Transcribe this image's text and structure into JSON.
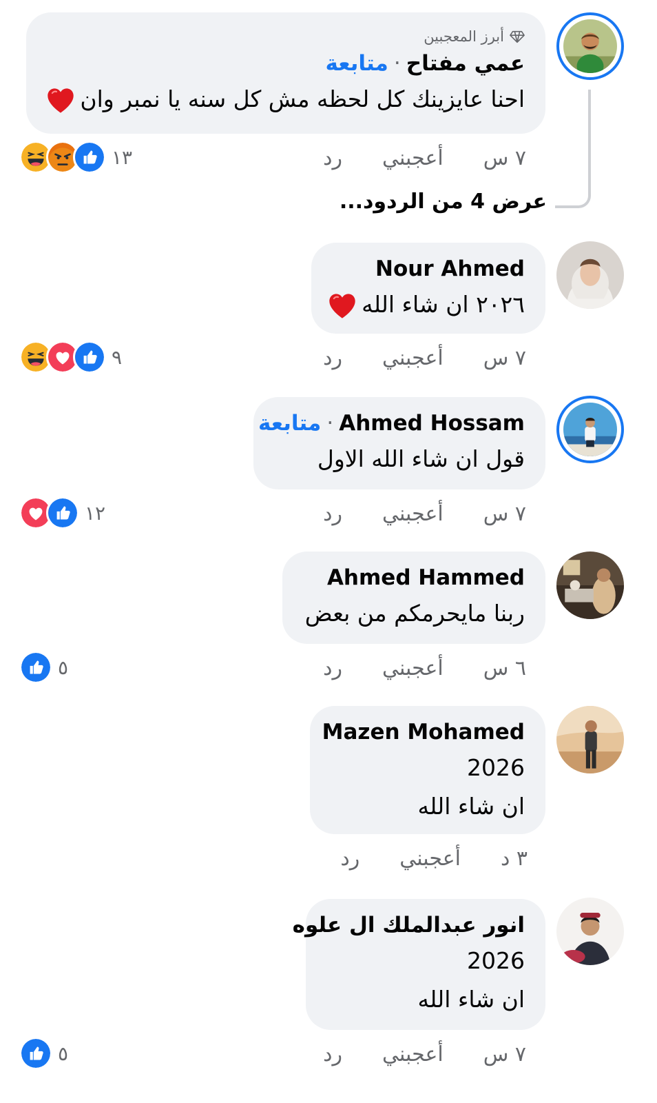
{
  "comments": [
    {
      "badge": "أبرز المعجبين",
      "name": "عمي مفتاح",
      "follow": "متابعة",
      "text": "احنا عايزينك كل لحظه مش كل سنه يا نمبر وان",
      "time": "٧ س",
      "like": "أعجبني",
      "reply": "رد",
      "reaction_count": "١٣",
      "reactions": [
        "haha-icon",
        "angry-icon",
        "like-icon"
      ],
      "view_replies": "عرض 4 من الردود..."
    },
    {
      "name": "Nour Ahmed",
      "text": "٢٠٢٦ ان شاء الله",
      "time": "٧ س",
      "like": "أعجبني",
      "reply": "رد",
      "reaction_count": "٩",
      "reactions": [
        "haha-icon",
        "love-icon",
        "like-icon"
      ]
    },
    {
      "name": "Ahmed Hossam",
      "follow": "متابعة",
      "text": "قول ان شاء الله الاول",
      "time": "٧ س",
      "like": "أعجبني",
      "reply": "رد",
      "reaction_count": "١٢",
      "reactions": [
        "love-icon",
        "like-icon"
      ]
    },
    {
      "name": "Ahmed Hammed",
      "text": "ربنا مايحرمكم من بعض",
      "time": "٦ س",
      "like": "أعجبني",
      "reply": "رد",
      "reaction_count": "٥",
      "reactions": [
        "like-icon"
      ]
    },
    {
      "name": "Mazen Mohamed",
      "text_line1": "2026",
      "text_line2": "ان شاء الله",
      "time": "٣ د",
      "like": "أعجبني",
      "reply": "رد"
    },
    {
      "name": "انور عبدالملك ال علوه",
      "text_line1": "2026",
      "text_line2": "ان شاء الله",
      "time": "٧ س",
      "like": "أعجبني",
      "reply": "رد",
      "reaction_count": "٥",
      "reactions": [
        "like-icon"
      ]
    }
  ],
  "colors": {
    "accent": "#1877f2",
    "bubble": "#f0f2f5",
    "secondary_text": "#65676b",
    "like": "#1877f2",
    "love": "#f33e58",
    "haha": "#f7b125",
    "angry": "#e9710f"
  }
}
